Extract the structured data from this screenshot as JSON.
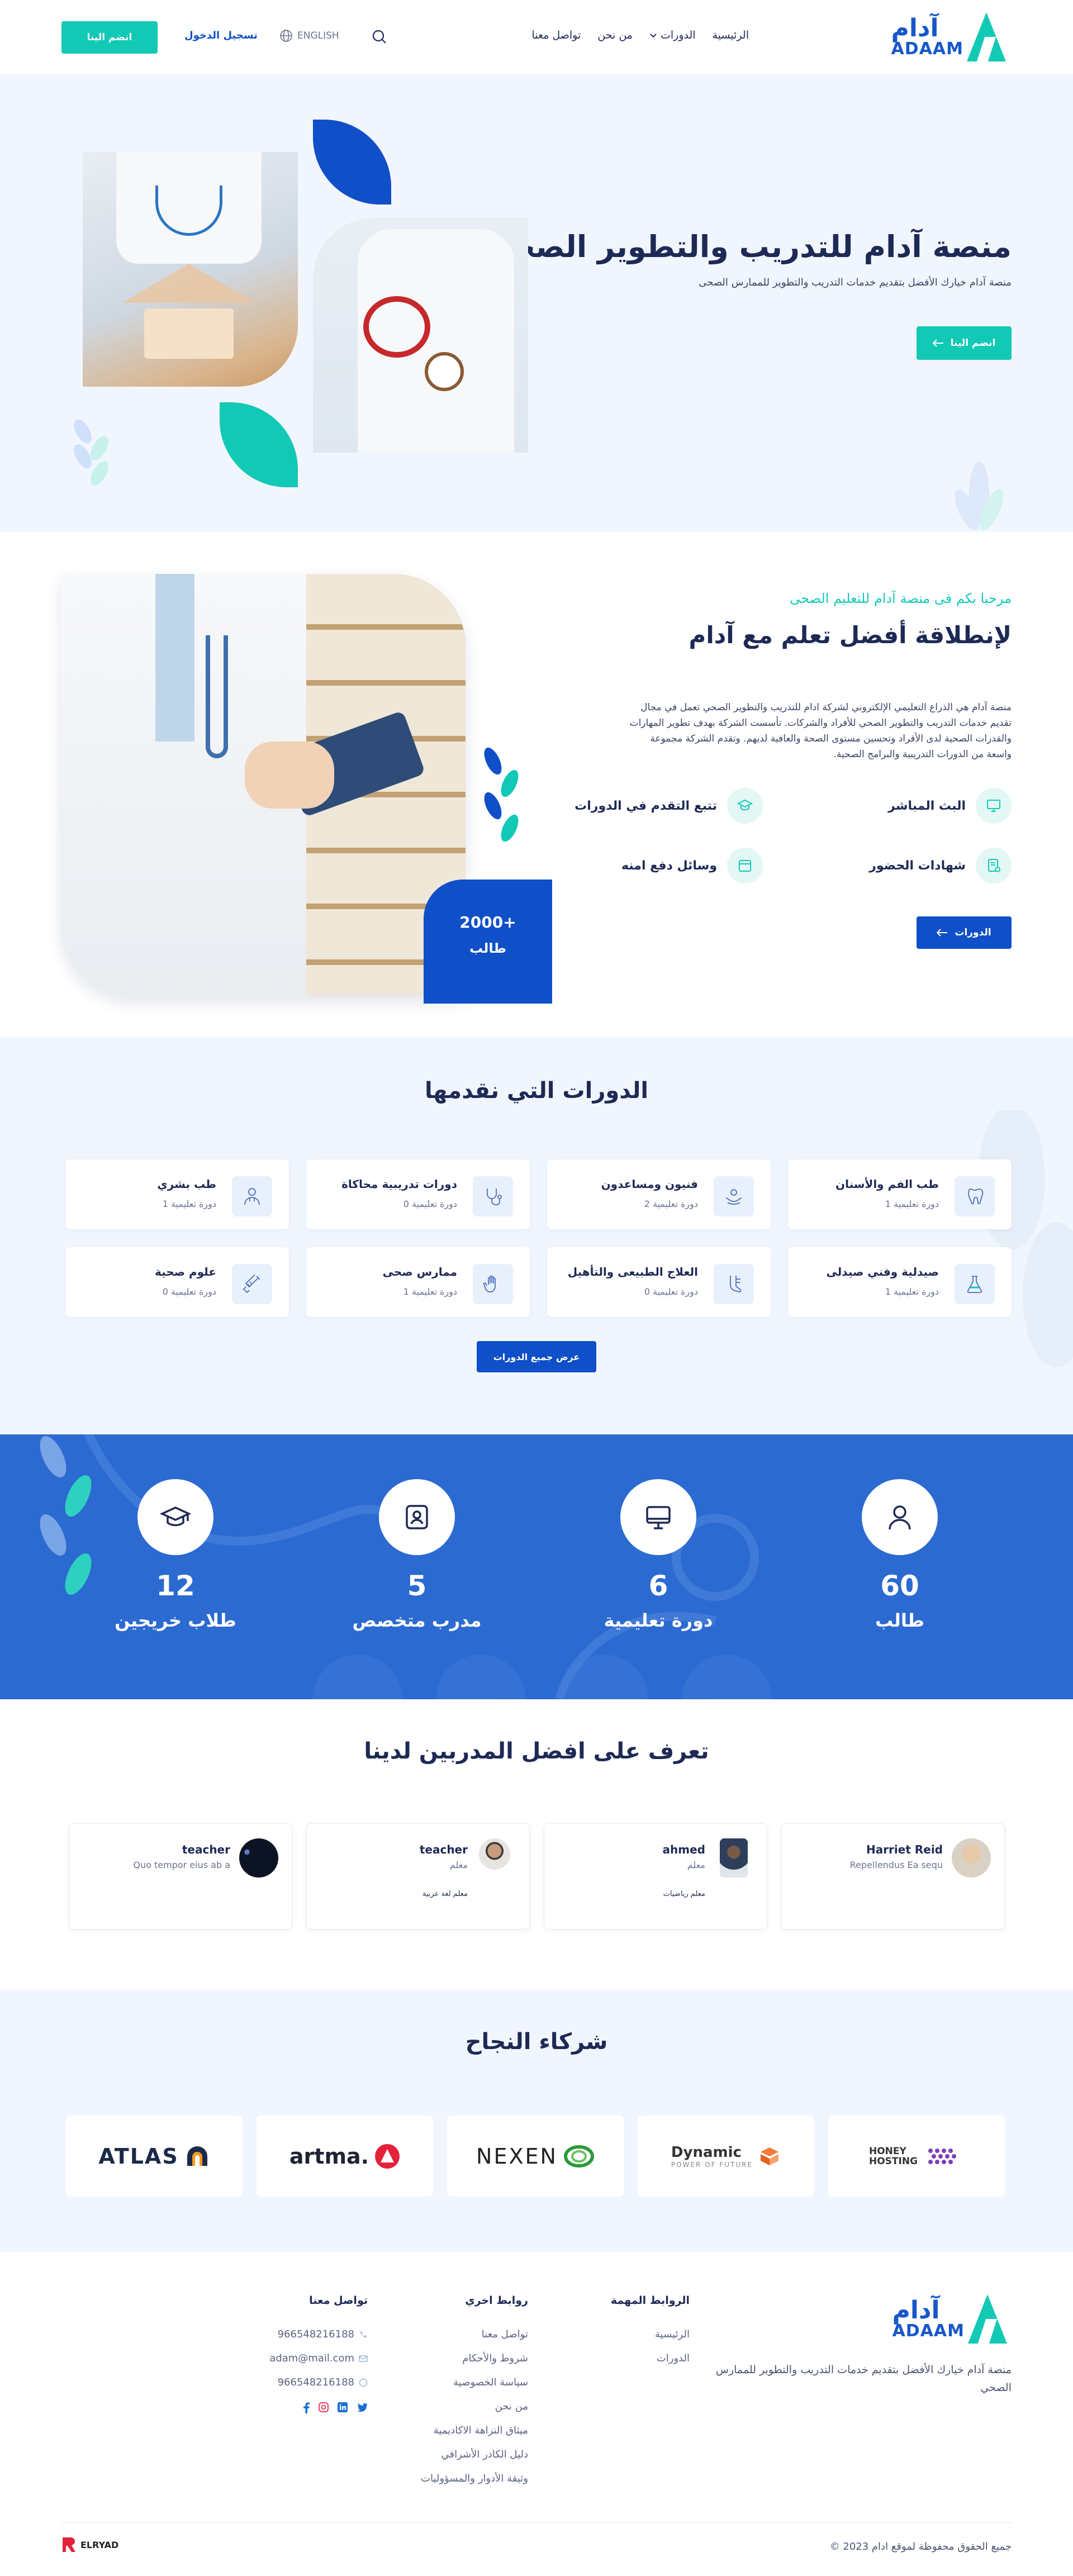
{
  "header": {
    "logo_ar": "آدام",
    "logo_en": "ADAAM",
    "nav": [
      "الرئيسية",
      "الدورات",
      "من نحن",
      "تواصل معنا"
    ],
    "lang": "ENGLISH",
    "login": "تسجيل الدخول",
    "join": "انضم الينا"
  },
  "hero": {
    "title": "منصة آدام للتدريب والتطوير الصحى",
    "subtitle": "منصة آدام خيارك الأفضل بتقديم خدمات التدريب والتطوير للممارس الصحى",
    "cta": "انضم الينا"
  },
  "welcome": {
    "kicker": "مرحبا بكم فى منصة آدام للتعليم الصحى",
    "title": "لإنطلاقة أفضل تعلم مع آدام",
    "paragraph": "منصة آدام هي الذراع التعليمي الإلكتروني لشركة ادام للتدريب والتطوير الصحي تعمل في مجال تقديم خدمات التدريب والتطوير الصحي للأفراد والشركات. تأسست الشركة بهدف تطوير المهارات والقدرات الصحية لدى الأفراد وتحسين مستوى الصحة والعافية لديهم. وتقدم الشركة مجموعة واسعة من الدورات التدريبية والبرامج الصحية.",
    "features": [
      "البث المباشر",
      "تتبع التقدم في الدورات",
      "شهادات الحضور",
      "وسائل دفع امنه"
    ],
    "cta": "الدورات",
    "badge_num": "+2000",
    "badge_lbl": "طالب"
  },
  "courses": {
    "title": "الدورات التي نقدمها",
    "items": [
      {
        "title": "طب الفم والأسنان",
        "sub": "دورة تعليمية 1"
      },
      {
        "title": "فنيون ومساعدون",
        "sub": "دورة تعليمية 2"
      },
      {
        "title": "دورات تدريبية محاكاة",
        "sub": "دورة تعليمية 0"
      },
      {
        "title": "طب بشري",
        "sub": "دورة تعليمية 1"
      },
      {
        "title": "صيدلية وفني صيدلى",
        "sub": "دورة تعليمية 1"
      },
      {
        "title": "العلاج الطبيعى والتأهيل",
        "sub": "دورة تعليمية 0"
      },
      {
        "title": "ممارس صحى",
        "sub": "دورة تعليمية 1"
      },
      {
        "title": "علوم صحية",
        "sub": "دورة تعليمية 0"
      }
    ],
    "cta": "عرض جميع الدورات"
  },
  "stats": [
    {
      "num": "60",
      "label": "طالب"
    },
    {
      "num": "6",
      "label": "دورة تعليمية"
    },
    {
      "num": "5",
      "label": "مدرب متخصص"
    },
    {
      "num": "12",
      "label": "طلاب خريجين"
    }
  ],
  "trainers": {
    "title": "تعرف على افضل المدربين لدينا",
    "items": [
      {
        "name": "Harriet Reid",
        "role": "Repellendus Ea sequ",
        "tag": ""
      },
      {
        "name": "ahmed",
        "role": "معلم",
        "tag": "معلم رياضيات"
      },
      {
        "name": "teacher",
        "role": "معلم",
        "tag": "معلم لغة عربية"
      },
      {
        "name": "teacher",
        "role": "Quo tempor eius ab a",
        "tag": ""
      }
    ]
  },
  "partners": {
    "title": "شركاء النجاح",
    "logos": [
      "HONEY HOSTING",
      "Dynamic",
      "NEXEN",
      "artma.",
      "ATLAS"
    ],
    "dynamic_sub": "POWER OF FUTURE"
  },
  "footer": {
    "about": "منصة آدام خيارك الأفضل بتقديم خدمات التدريب والتطوير للممارس الصحي",
    "important_title": "الروابط المهمة",
    "important": [
      "الرئيسية",
      "الدورات"
    ],
    "other_title": "روابط اخري",
    "other": [
      "تواصل معنا",
      "شروط والأحكام",
      "سياسة الخصوصية",
      "من نحن",
      "ميثاق النزاهة الاكاديمية",
      "دليل الكادر الأشرافي",
      "وثيقة الأدوار والمسؤوليات"
    ],
    "contact_title": "تواصل معنا",
    "contact": [
      "966548216188",
      "adam@mail.com",
      "966548216188"
    ],
    "copyright": "جميع الحقوق محفوظة لموقع ادام 2023 ©",
    "credit": "ELRYAD"
  },
  "colors": {
    "teal": "#12c9b6",
    "blue": "#0f4fc8",
    "navy": "#1e2a55",
    "stats_bg": "#2b6ad1"
  }
}
